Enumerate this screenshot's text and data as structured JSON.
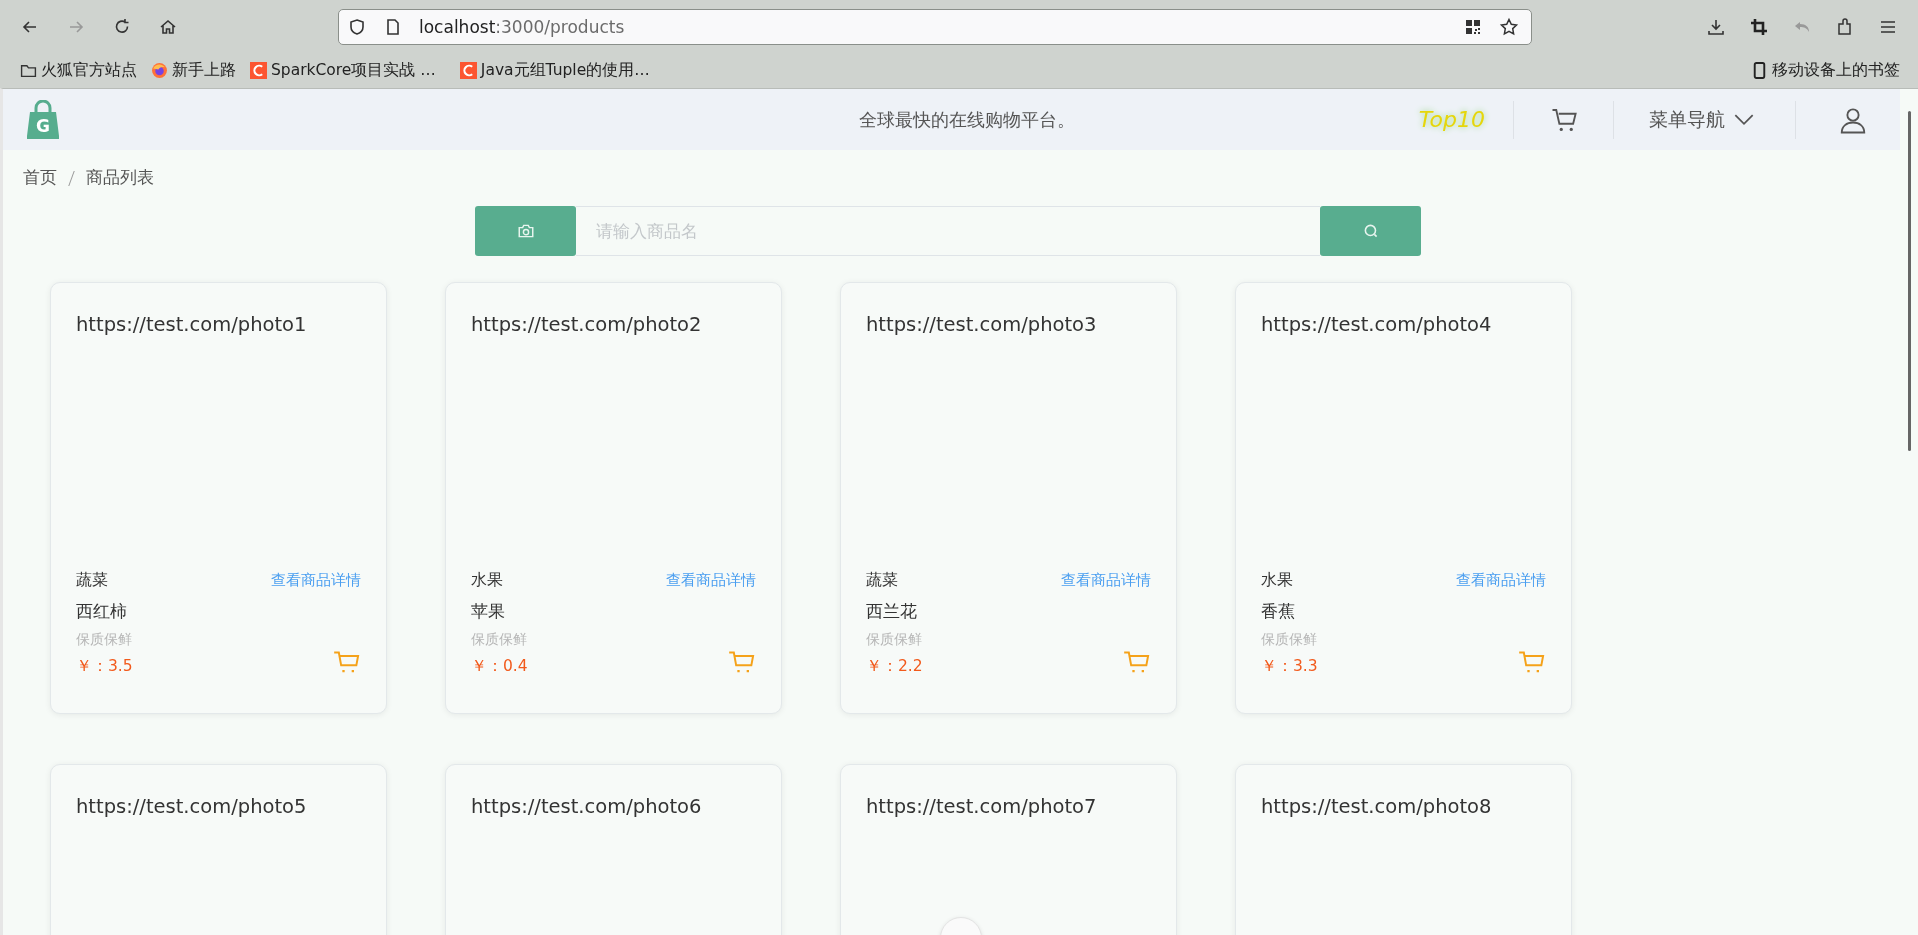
{
  "browser": {
    "url_host": "localhost",
    "url_path": ":3000/products",
    "bookmarks": [
      {
        "label": "火狐官方站点",
        "kind": "folder"
      },
      {
        "label": "新手上路",
        "kind": "firefox"
      },
      {
        "label": "SparkCore项目实战 …",
        "kind": "csdn"
      },
      {
        "label": "Java元组Tuple的使用…",
        "kind": "csdn"
      }
    ],
    "mobile_bookmarks": "移动设备上的书签"
  },
  "header": {
    "logo_letter": "G",
    "slogan": "全球最快的在线购物平台。",
    "top_link": "Top10",
    "menu": "菜单导航"
  },
  "breadcrumb": [
    {
      "label": "首页"
    },
    {
      "label": "商品列表"
    }
  ],
  "search": {
    "placeholder": "请输入商品名"
  },
  "products": [
    {
      "image_alt": "https://test.com/photo1",
      "category": "蔬菜",
      "detail_link": "查看商品详情",
      "name": "西红柿",
      "desc": "保质保鲜",
      "price": "￥：3.5"
    },
    {
      "image_alt": "https://test.com/photo2",
      "category": "水果",
      "detail_link": "查看商品详情",
      "name": "苹果",
      "desc": "保质保鲜",
      "price": "￥：0.4"
    },
    {
      "image_alt": "https://test.com/photo3",
      "category": "蔬菜",
      "detail_link": "查看商品详情",
      "name": "西兰花",
      "desc": "保质保鲜",
      "price": "￥：2.2"
    },
    {
      "image_alt": "https://test.com/photo4",
      "category": "水果",
      "detail_link": "查看商品详情",
      "name": "香蕉",
      "desc": "保质保鲜",
      "price": "￥：3.3"
    },
    {
      "image_alt": "https://test.com/photo5"
    },
    {
      "image_alt": "https://test.com/photo6"
    },
    {
      "image_alt": "https://test.com/photo7"
    },
    {
      "image_alt": "https://test.com/photo8"
    }
  ]
}
